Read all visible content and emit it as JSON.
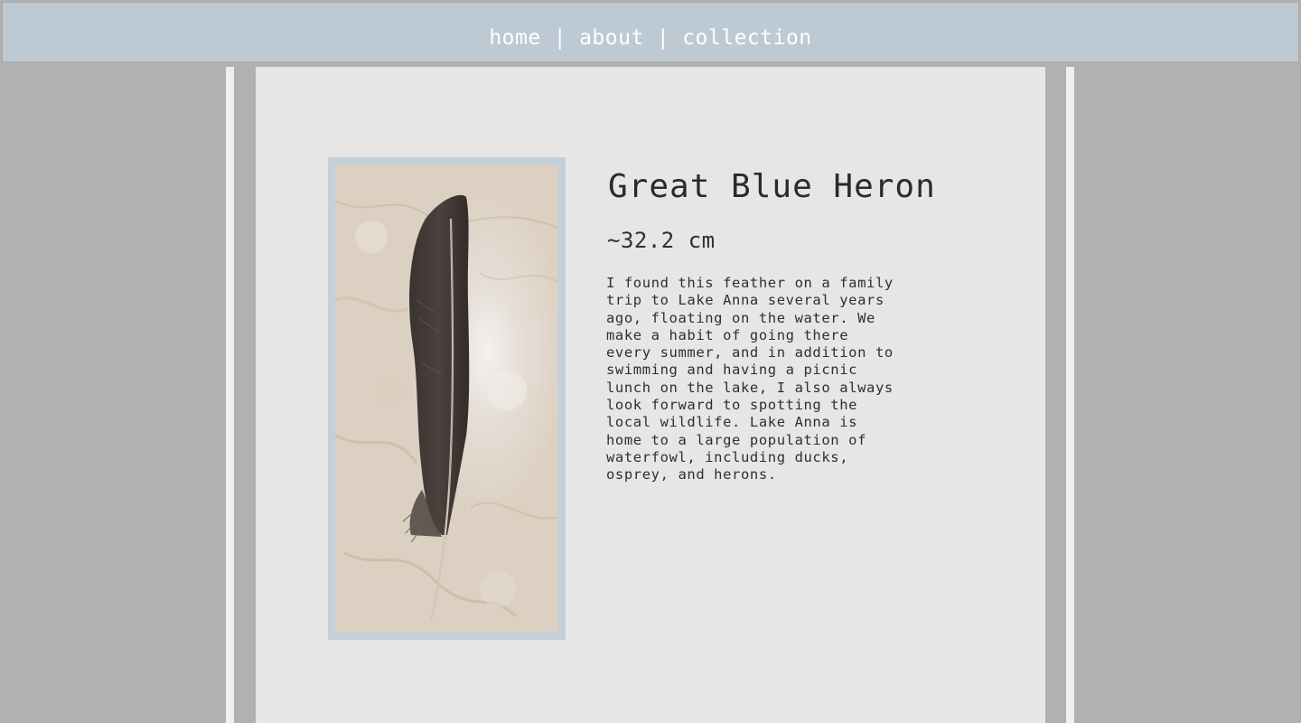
{
  "nav": {
    "items": [
      {
        "label": "home"
      },
      {
        "label": "about"
      },
      {
        "label": "collection"
      }
    ],
    "separator": "|"
  },
  "feather": {
    "name": "Great Blue Heron",
    "length": "~32.2 cm",
    "description": "I found this feather on a family\ntrip to Lake Anna several years\nago, floating on the water. We\nmake a habit of going there\nevery summer, and in addition to\nswimming and having a picnic\nlunch on the lake, I also always\nlook forward to spotting the\nlocal wildlife. Lake Anna is\nhome to a large population of\nwaterfowl, including ducks,\nosprey, and herons.",
    "photo_icon": "feather-photo"
  },
  "colors": {
    "nav_bg": "#bdcad3",
    "page_bg": "#b1b1b1",
    "panel_bg": "#e6e6e6",
    "frame": "#c3d0d9"
  }
}
